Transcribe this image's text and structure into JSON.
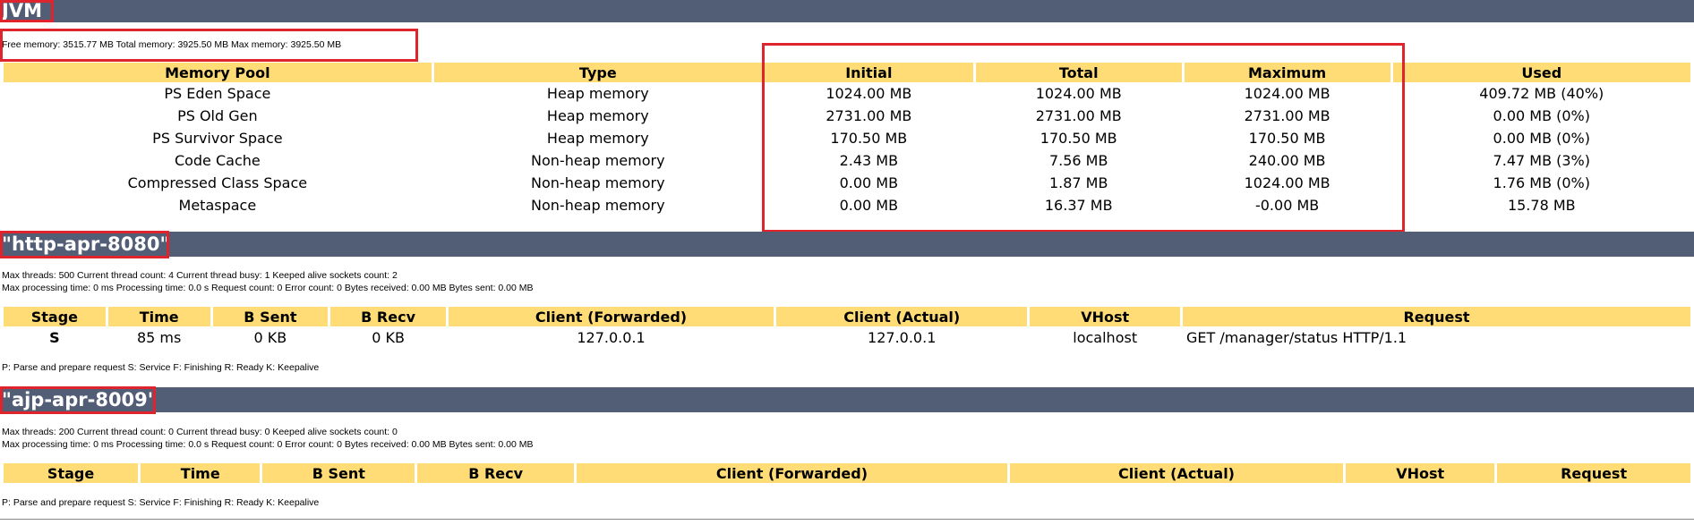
{
  "jvm": {
    "heading": "JVM",
    "memory_summary": "Free memory: 3515.77 MB Total memory: 3925.50 MB Max memory: 3925.50 MB",
    "columns": [
      "Memory Pool",
      "Type",
      "Initial",
      "Total",
      "Maximum",
      "Used"
    ],
    "rows": [
      [
        "PS Eden Space",
        "Heap memory",
        "1024.00 MB",
        "1024.00 MB",
        "1024.00 MB",
        "409.72 MB (40%)"
      ],
      [
        "PS Old Gen",
        "Heap memory",
        "2731.00 MB",
        "2731.00 MB",
        "2731.00 MB",
        "0.00 MB (0%)"
      ],
      [
        "PS Survivor Space",
        "Heap memory",
        "170.50 MB",
        "170.50 MB",
        "170.50 MB",
        "0.00 MB (0%)"
      ],
      [
        "Code Cache",
        "Non-heap memory",
        "2.43 MB",
        "7.56 MB",
        "240.00 MB",
        "7.47 MB (3%)"
      ],
      [
        "Compressed Class Space",
        "Non-heap memory",
        "0.00 MB",
        "1.87 MB",
        "1024.00 MB",
        "1.76 MB (0%)"
      ],
      [
        "Metaspace",
        "Non-heap memory",
        "0.00 MB",
        "16.37 MB",
        "-0.00 MB",
        "15.78 MB"
      ]
    ]
  },
  "http": {
    "heading": "\"http-apr-8080\"",
    "line1": "Max threads: 500 Current thread count: 4 Current thread busy: 1 Keeped alive sockets count: 2",
    "line2": "Max processing time: 0 ms Processing time: 0.0 s Request count: 0 Error count: 0 Bytes received: 0.00 MB Bytes sent: 0.00 MB",
    "columns": [
      "Stage",
      "Time",
      "B Sent",
      "B Recv",
      "Client (Forwarded)",
      "Client (Actual)",
      "VHost",
      "Request"
    ],
    "row": [
      "S",
      "85 ms",
      "0 KB",
      "0 KB",
      "127.0.0.1",
      "127.0.0.1",
      "localhost",
      "GET /manager/status HTTP/1.1"
    ],
    "legend": "P: Parse and prepare request S: Service F: Finishing R: Ready K: Keepalive"
  },
  "ajp": {
    "heading": "\"ajp-apr-8009\"",
    "line1": "Max threads: 200 Current thread count: 0 Current thread busy: 0 Keeped alive sockets count: 0",
    "line2": "Max processing time: 0 ms Processing time: 0.0 s Request count: 0 Error count: 0 Bytes received: 0.00 MB Bytes sent: 0.00 MB",
    "columns": [
      "Stage",
      "Time",
      "B Sent",
      "B Recv",
      "Client (Forwarded)",
      "Client (Actual)",
      "VHost",
      "Request"
    ],
    "legend": "P: Parse and prepare request S: Service F: Finishing R: Ready K: Keepalive"
  },
  "colors": {
    "header_band": "#525d76",
    "table_header": "#ffdc75",
    "highlight_box": "#e0242e"
  }
}
